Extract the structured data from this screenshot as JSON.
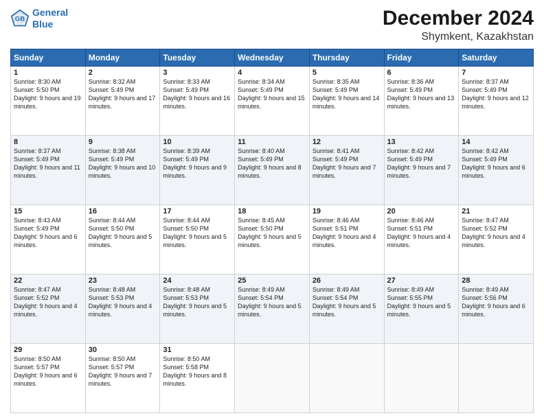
{
  "header": {
    "logo_line1": "General",
    "logo_line2": "Blue",
    "month": "December 2024",
    "location": "Shymkent, Kazakhstan"
  },
  "days_of_week": [
    "Sunday",
    "Monday",
    "Tuesday",
    "Wednesday",
    "Thursday",
    "Friday",
    "Saturday"
  ],
  "weeks": [
    [
      {
        "day": 1,
        "sunrise": "8:30 AM",
        "sunset": "5:50 PM",
        "daylight": "9 hours and 19 minutes."
      },
      {
        "day": 2,
        "sunrise": "8:32 AM",
        "sunset": "5:49 PM",
        "daylight": "9 hours and 17 minutes."
      },
      {
        "day": 3,
        "sunrise": "8:33 AM",
        "sunset": "5:49 PM",
        "daylight": "9 hours and 16 minutes."
      },
      {
        "day": 4,
        "sunrise": "8:34 AM",
        "sunset": "5:49 PM",
        "daylight": "9 hours and 15 minutes."
      },
      {
        "day": 5,
        "sunrise": "8:35 AM",
        "sunset": "5:49 PM",
        "daylight": "9 hours and 14 minutes."
      },
      {
        "day": 6,
        "sunrise": "8:36 AM",
        "sunset": "5:49 PM",
        "daylight": "9 hours and 13 minutes."
      },
      {
        "day": 7,
        "sunrise": "8:37 AM",
        "sunset": "5:49 PM",
        "daylight": "9 hours and 12 minutes."
      }
    ],
    [
      {
        "day": 8,
        "sunrise": "8:37 AM",
        "sunset": "5:49 PM",
        "daylight": "9 hours and 11 minutes."
      },
      {
        "day": 9,
        "sunrise": "8:38 AM",
        "sunset": "5:49 PM",
        "daylight": "9 hours and 10 minutes."
      },
      {
        "day": 10,
        "sunrise": "8:39 AM",
        "sunset": "5:49 PM",
        "daylight": "9 hours and 9 minutes."
      },
      {
        "day": 11,
        "sunrise": "8:40 AM",
        "sunset": "5:49 PM",
        "daylight": "9 hours and 8 minutes."
      },
      {
        "day": 12,
        "sunrise": "8:41 AM",
        "sunset": "5:49 PM",
        "daylight": "9 hours and 7 minutes."
      },
      {
        "day": 13,
        "sunrise": "8:42 AM",
        "sunset": "5:49 PM",
        "daylight": "9 hours and 7 minutes."
      },
      {
        "day": 14,
        "sunrise": "8:42 AM",
        "sunset": "5:49 PM",
        "daylight": "9 hours and 6 minutes."
      }
    ],
    [
      {
        "day": 15,
        "sunrise": "8:43 AM",
        "sunset": "5:49 PM",
        "daylight": "9 hours and 6 minutes."
      },
      {
        "day": 16,
        "sunrise": "8:44 AM",
        "sunset": "5:50 PM",
        "daylight": "9 hours and 5 minutes."
      },
      {
        "day": 17,
        "sunrise": "8:44 AM",
        "sunset": "5:50 PM",
        "daylight": "9 hours and 5 minutes."
      },
      {
        "day": 18,
        "sunrise": "8:45 AM",
        "sunset": "5:50 PM",
        "daylight": "9 hours and 5 minutes."
      },
      {
        "day": 19,
        "sunrise": "8:46 AM",
        "sunset": "5:51 PM",
        "daylight": "9 hours and 4 minutes."
      },
      {
        "day": 20,
        "sunrise": "8:46 AM",
        "sunset": "5:51 PM",
        "daylight": "9 hours and 4 minutes."
      },
      {
        "day": 21,
        "sunrise": "8:47 AM",
        "sunset": "5:52 PM",
        "daylight": "9 hours and 4 minutes."
      }
    ],
    [
      {
        "day": 22,
        "sunrise": "8:47 AM",
        "sunset": "5:52 PM",
        "daylight": "9 hours and 4 minutes."
      },
      {
        "day": 23,
        "sunrise": "8:48 AM",
        "sunset": "5:53 PM",
        "daylight": "9 hours and 4 minutes."
      },
      {
        "day": 24,
        "sunrise": "8:48 AM",
        "sunset": "5:53 PM",
        "daylight": "9 hours and 5 minutes."
      },
      {
        "day": 25,
        "sunrise": "8:49 AM",
        "sunset": "5:54 PM",
        "daylight": "9 hours and 5 minutes."
      },
      {
        "day": 26,
        "sunrise": "8:49 AM",
        "sunset": "5:54 PM",
        "daylight": "9 hours and 5 minutes."
      },
      {
        "day": 27,
        "sunrise": "8:49 AM",
        "sunset": "5:55 PM",
        "daylight": "9 hours and 5 minutes."
      },
      {
        "day": 28,
        "sunrise": "8:49 AM",
        "sunset": "5:56 PM",
        "daylight": "9 hours and 6 minutes."
      }
    ],
    [
      {
        "day": 29,
        "sunrise": "8:50 AM",
        "sunset": "5:57 PM",
        "daylight": "9 hours and 6 minutes."
      },
      {
        "day": 30,
        "sunrise": "8:50 AM",
        "sunset": "5:57 PM",
        "daylight": "9 hours and 7 minutes."
      },
      {
        "day": 31,
        "sunrise": "8:50 AM",
        "sunset": "5:58 PM",
        "daylight": "9 hours and 8 minutes."
      },
      null,
      null,
      null,
      null
    ]
  ]
}
